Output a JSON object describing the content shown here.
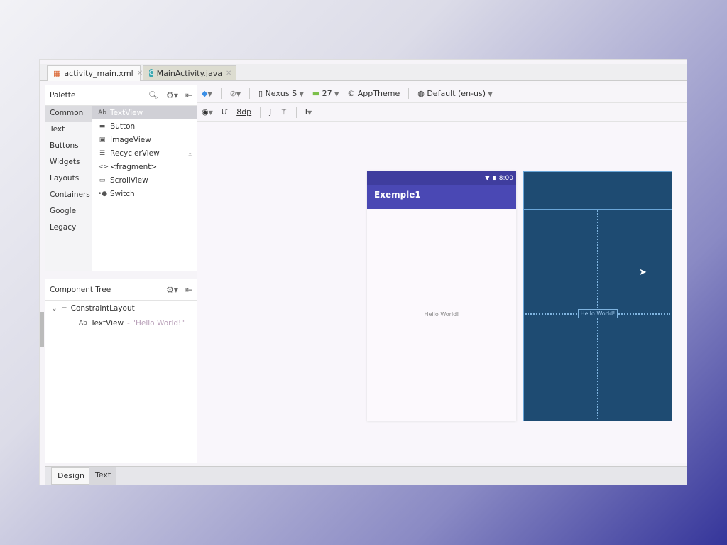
{
  "tabs": [
    {
      "label": "activity_main.xml",
      "active": true
    },
    {
      "label": "MainActivity.java",
      "active": false
    }
  ],
  "palette": {
    "title": "Palette",
    "categories": [
      "Common",
      "Text",
      "Buttons",
      "Widgets",
      "Layouts",
      "Containers",
      "Google",
      "Legacy"
    ],
    "items": [
      {
        "icon": "Ab",
        "label": "TextView"
      },
      {
        "icon": "▬",
        "label": "Button"
      },
      {
        "icon": "▣",
        "label": "ImageView"
      },
      {
        "icon": "☰",
        "label": "RecyclerView"
      },
      {
        "icon": "<>",
        "label": "<fragment>"
      },
      {
        "icon": "▭",
        "label": "ScrollView"
      },
      {
        "icon": "•●",
        "label": "Switch"
      }
    ]
  },
  "component_tree": {
    "title": "Component Tree",
    "root": "ConstraintLayout",
    "child_icon": "Ab",
    "child": "TextView",
    "child_value": "- \"Hello World!\""
  },
  "toolbar": {
    "device": "Nexus S",
    "api": "27",
    "theme": "AppTheme",
    "locale": "Default (en-us)",
    "margin": "8dp"
  },
  "preview": {
    "time": "8:00",
    "app_title": "Exemple1",
    "text": "Hello World!",
    "blueprint_text": "Hello World!"
  },
  "bottom_tabs": [
    "Design",
    "Text"
  ],
  "colors": {
    "appbar": "#4a48b4",
    "blueprint": "#1e4b72"
  }
}
